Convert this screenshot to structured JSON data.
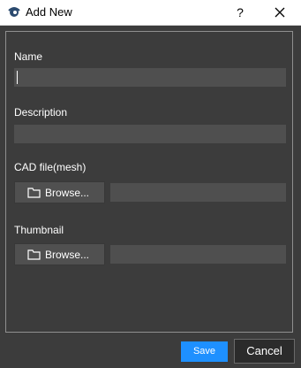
{
  "window": {
    "title": "Add New",
    "help_label": "?",
    "icon": "app-logo-icon",
    "close_icon": "close-icon"
  },
  "form": {
    "name_label": "Name",
    "name_value": "",
    "description_label": "Description",
    "description_value": "",
    "cad_label": "CAD file(mesh)",
    "cad_browse_label": "Browse...",
    "cad_path": "",
    "thumbnail_label": "Thumbnail",
    "thumbnail_browse_label": "Browse...",
    "thumbnail_path": ""
  },
  "actions": {
    "save_label": "Save",
    "cancel_label": "Cancel"
  },
  "colors": {
    "background": "#3c3c3c",
    "field": "#4f4f4f",
    "accent": "#1e90ff"
  }
}
